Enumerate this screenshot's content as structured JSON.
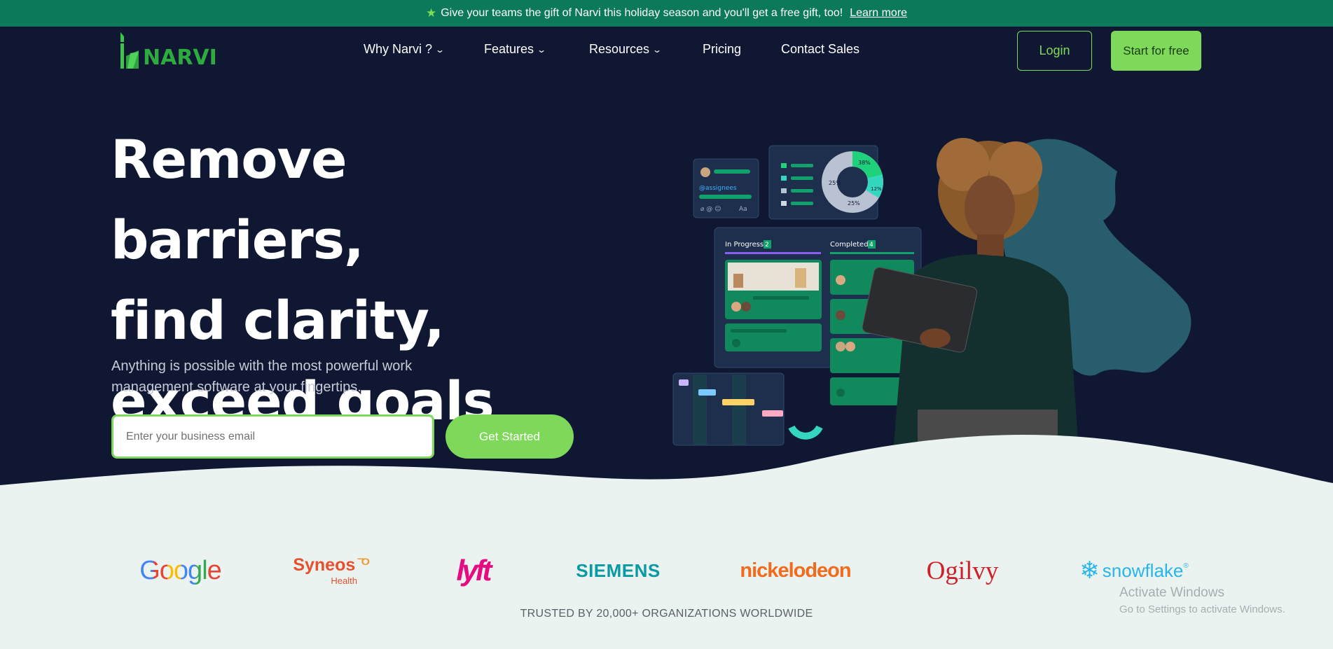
{
  "announcement": {
    "text": "Give your teams the gift of Narvi this holiday season and you'll get a free gift, too!",
    "link": "Learn more",
    "icon": "star-icon",
    "accent": "#7edb5a"
  },
  "header": {
    "logo_text": "NARVI",
    "nav": [
      {
        "label": "Why Narvi ?",
        "has_dropdown": true
      },
      {
        "label": "Features",
        "has_dropdown": true
      },
      {
        "label": "Resources",
        "has_dropdown": true
      },
      {
        "label": "Pricing",
        "has_dropdown": false
      },
      {
        "label": "Contact Sales",
        "has_dropdown": false
      }
    ],
    "login_label": "Login",
    "start_label": "Start for free"
  },
  "hero": {
    "title_lines": [
      "Remove barriers,",
      "find clarity,",
      "exceed goals"
    ],
    "subtitle_lines": [
      "Anything is possible with the most powerful work",
      "management software at your fingertips."
    ],
    "email_placeholder": "Enter your business email",
    "cta_label": "Get Started"
  },
  "illustration": {
    "assignee_tag": "@assignees",
    "comment_tool_label": "Aa",
    "donut_labels": [
      "38%",
      "25%",
      "12%",
      "25%"
    ],
    "columns": [
      {
        "title": "In Progress",
        "count": "2"
      },
      {
        "title": "Completed",
        "count": "4"
      }
    ]
  },
  "brands": [
    {
      "name": "Google"
    },
    {
      "name": "Syneos",
      "sub": "Health"
    },
    {
      "name": "lyft"
    },
    {
      "name": "SIEMENS"
    },
    {
      "name": "nickelodeon"
    },
    {
      "name": "Ogilvy"
    },
    {
      "name": "snowflake",
      "mark": "®"
    }
  ],
  "trusted_text": "TRUSTED BY 20,000+ ORGANIZATIONS WORLDWIDE",
  "watermark": {
    "title": "Activate Windows",
    "sub": "Go to Settings to activate Windows."
  },
  "colors": {
    "announce_bg": "#0c7a5a",
    "page_bg": "#0f1733",
    "accent_green": "#7ed95b",
    "lower_bg": "#ebf3f1"
  }
}
